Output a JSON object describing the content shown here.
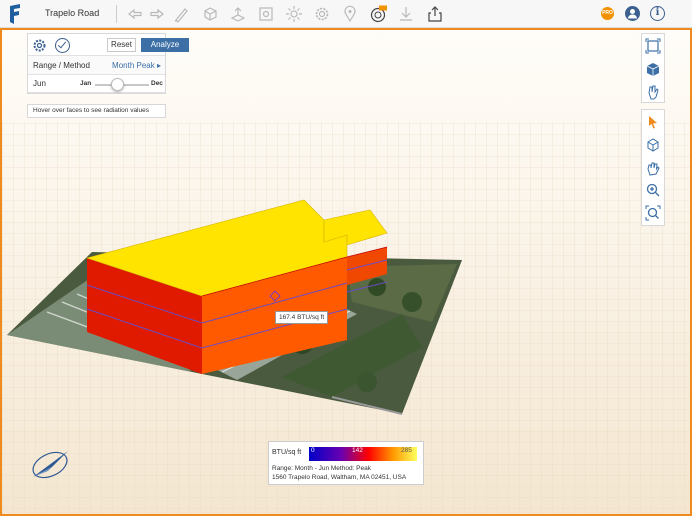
{
  "app": {
    "title": "Trapelo Road",
    "pro_badge": "PRO",
    "info_symbol": "i"
  },
  "toolbar": {
    "icons": [
      "undo-icon",
      "redo-icon",
      "draw-icon",
      "box-icon",
      "extrude-icon",
      "edit-icon",
      "sun-icon",
      "settings-icon",
      "location-icon",
      "png-export-icon",
      "import-icon",
      "share-icon"
    ]
  },
  "panel": {
    "reset_label": "Reset",
    "analyze_label": "Analyze",
    "range_label": "Range / Method",
    "range_value": "Month Peak",
    "month_label": "Jun",
    "slider_min": "Jan",
    "slider_max": "Dec",
    "slider_fraction": 0.42,
    "hint": "Hover over faces to see radiation values"
  },
  "tooltip": {
    "text": "167.4 BTU/sq ft"
  },
  "legend": {
    "unit": "BTU/sq ft",
    "ticks": [
      "0",
      "142",
      "285"
    ],
    "range_line": "Range: Month - Jun   Method: Peak",
    "address": "1560 Trapelo Road, Waltham, MA 02451, USA"
  },
  "colors": {
    "accent": "#ef8a1e",
    "primary": "#3b6fa6",
    "roof": "#ffe400",
    "wall_light": "#ff5a00",
    "wall_dark": "#e01a00",
    "ground": "#f1e2cb"
  }
}
